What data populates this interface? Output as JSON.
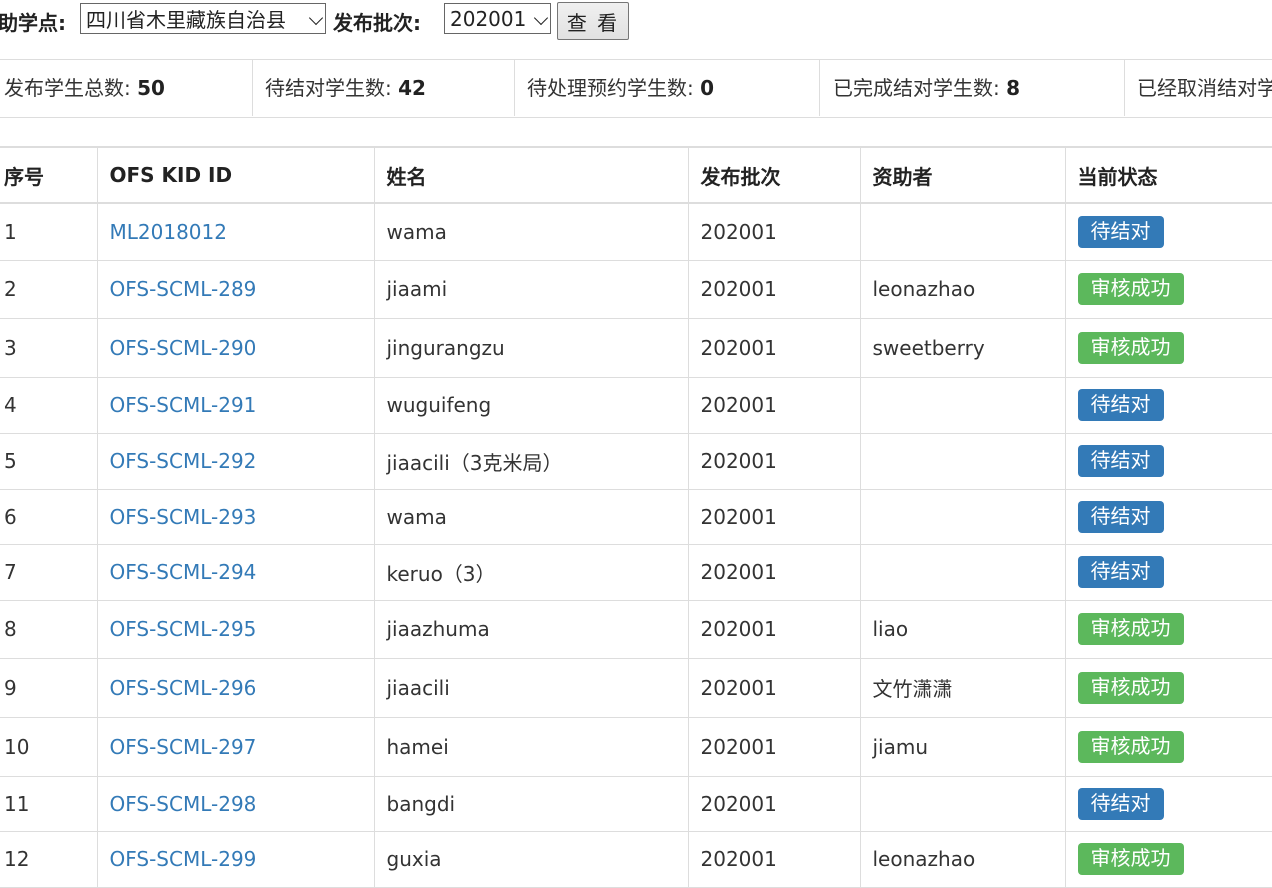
{
  "filters": {
    "school_label": "助学点:",
    "school_value": "四川省木里藏族自治县",
    "batch_label": "发布批次:",
    "batch_value": "202001",
    "view_button": "查 看"
  },
  "stats": [
    {
      "label": "发布学生总数: ",
      "value": "50"
    },
    {
      "label": "待结对学生数: ",
      "value": "42"
    },
    {
      "label": "待处理预约学生数: ",
      "value": "0"
    },
    {
      "label": "已完成结对学生数: ",
      "value": "8"
    },
    {
      "label": "已经取消结对学生数: ",
      "value": ""
    }
  ],
  "table": {
    "headers": [
      "序号",
      "OFS KID ID",
      "姓名",
      "发布批次",
      "资助者",
      "当前状态"
    ],
    "rows": [
      {
        "no": "1",
        "kid": "ML2018012",
        "name": "wama",
        "batch": "202001",
        "sponsor": "",
        "status": "待结对",
        "status_type": "pending",
        "h": 57
      },
      {
        "no": "2",
        "kid": "OFS-SCML-289",
        "name": "jiaami",
        "batch": "202001",
        "sponsor": "leonazhao",
        "status": "审核成功",
        "status_type": "approved",
        "h": 58
      },
      {
        "no": "3",
        "kid": "OFS-SCML-290",
        "name": "jingurangzu",
        "batch": "202001",
        "sponsor": "sweetberry",
        "status": "审核成功",
        "status_type": "approved",
        "h": 59
      },
      {
        "no": "4",
        "kid": "OFS-SCML-291",
        "name": "wuguifeng",
        "batch": "202001",
        "sponsor": "",
        "status": "待结对",
        "status_type": "pending",
        "h": 56
      },
      {
        "no": "5",
        "kid": "OFS-SCML-292",
        "name": "jiaacili（3克米局）",
        "batch": "202001",
        "sponsor": "",
        "status": "待结对",
        "status_type": "pending",
        "h": 56
      },
      {
        "no": "6",
        "kid": "OFS-SCML-293",
        "name": "wama",
        "batch": "202001",
        "sponsor": "",
        "status": "待结对",
        "status_type": "pending",
        "h": 55
      },
      {
        "no": "7",
        "kid": "OFS-SCML-294",
        "name": "keruo（3）",
        "batch": "202001",
        "sponsor": "",
        "status": "待结对",
        "status_type": "pending",
        "h": 56
      },
      {
        "no": "8",
        "kid": "OFS-SCML-295",
        "name": "jiaazhuma",
        "batch": "202001",
        "sponsor": "liao",
        "status": "审核成功",
        "status_type": "approved",
        "h": 58
      },
      {
        "no": "9",
        "kid": "OFS-SCML-296",
        "name": "jiaacili",
        "batch": "202001",
        "sponsor": "文竹潇潇",
        "status": "审核成功",
        "status_type": "approved",
        "h": 59
      },
      {
        "no": "10",
        "kid": "OFS-SCML-297",
        "name": "hamei",
        "batch": "202001",
        "sponsor": "jiamu",
        "status": "审核成功",
        "status_type": "approved",
        "h": 59
      },
      {
        "no": "11",
        "kid": "OFS-SCML-298",
        "name": "bangdi",
        "batch": "202001",
        "sponsor": "",
        "status": "待结对",
        "status_type": "pending",
        "h": 55
      },
      {
        "no": "12",
        "kid": "OFS-SCML-299",
        "name": "guxia",
        "batch": "202001",
        "sponsor": "leonazhao",
        "status": "审核成功",
        "status_type": "approved",
        "h": 56
      }
    ]
  },
  "colors": {
    "link": "#337ab7",
    "pending_badge": "#337ab7",
    "approved_badge": "#5cb85c",
    "border": "#dddddd"
  }
}
